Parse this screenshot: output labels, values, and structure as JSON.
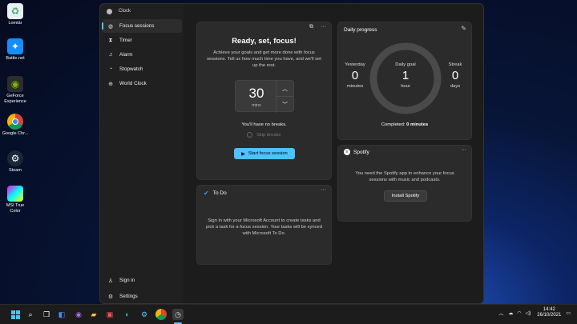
{
  "desktop": {
    "icons": [
      {
        "label": "Lomtár"
      },
      {
        "label": "Battle.net"
      },
      {
        "label": "GeForce Experience"
      },
      {
        "label": "Google Chr..."
      },
      {
        "label": "Steam"
      },
      {
        "label": "MSI True Color"
      }
    ]
  },
  "window": {
    "title": "Clock",
    "minimize": "—",
    "maximize": "☐",
    "close": "✕"
  },
  "sidebar": {
    "items": [
      {
        "label": "Focus sessions",
        "icon": "focus-icon",
        "glyph": "◍"
      },
      {
        "label": "Timer",
        "icon": "hourglass-icon",
        "glyph": "⧗"
      },
      {
        "label": "Alarm",
        "icon": "bell-icon",
        "glyph": "♫"
      },
      {
        "label": "Stopwatch",
        "icon": "stopwatch-icon",
        "glyph": "◔"
      },
      {
        "label": "World Clock",
        "icon": "globe-icon",
        "glyph": "⊕"
      }
    ],
    "bottom": [
      {
        "label": "Sign in",
        "icon": "person-icon",
        "glyph": "♙"
      },
      {
        "label": "Settings",
        "icon": "gear-icon",
        "glyph": "⚙"
      }
    ]
  },
  "focus_card": {
    "title": "Ready, set, focus!",
    "description": "Achieve your goals and get more done with focus sessions. Tell us how much time you have, and we'll set up the rest.",
    "minutes_value": "30",
    "minutes_unit": "mins",
    "no_breaks": "You'll have no breaks.",
    "skip_breaks": "Skip breaks",
    "start_button": "Start focus session"
  },
  "todo_card": {
    "title": "To Do",
    "text": "Sign in with your Microsoft Account to create tasks and pick a task for a focus session. Your tasks will be synced with Microsoft To Do."
  },
  "progress_card": {
    "title": "Daily progress",
    "yesterday_label": "Yesterday",
    "yesterday_value": "0",
    "yesterday_unit": "minutes",
    "goal_label": "Daily goal",
    "goal_value": "1",
    "goal_unit": "hour",
    "streak_label": "Streak",
    "streak_value": "0",
    "streak_unit": "days",
    "completed_label": "Completed:",
    "completed_value": "0 minutes",
    "progress_fraction": 0
  },
  "spotify_card": {
    "title": "Spotify",
    "text": "You need the Spotify app to enhance your focus sessions with music and podcasts.",
    "button": "Install Spotify"
  },
  "more_glyph": "···",
  "taskbar": {
    "time": "14:42",
    "date": "26/10/2021"
  },
  "colors": {
    "accent": "#4cc2ff",
    "card_bg": "#2b2b2b",
    "window_bg": "#202020"
  }
}
